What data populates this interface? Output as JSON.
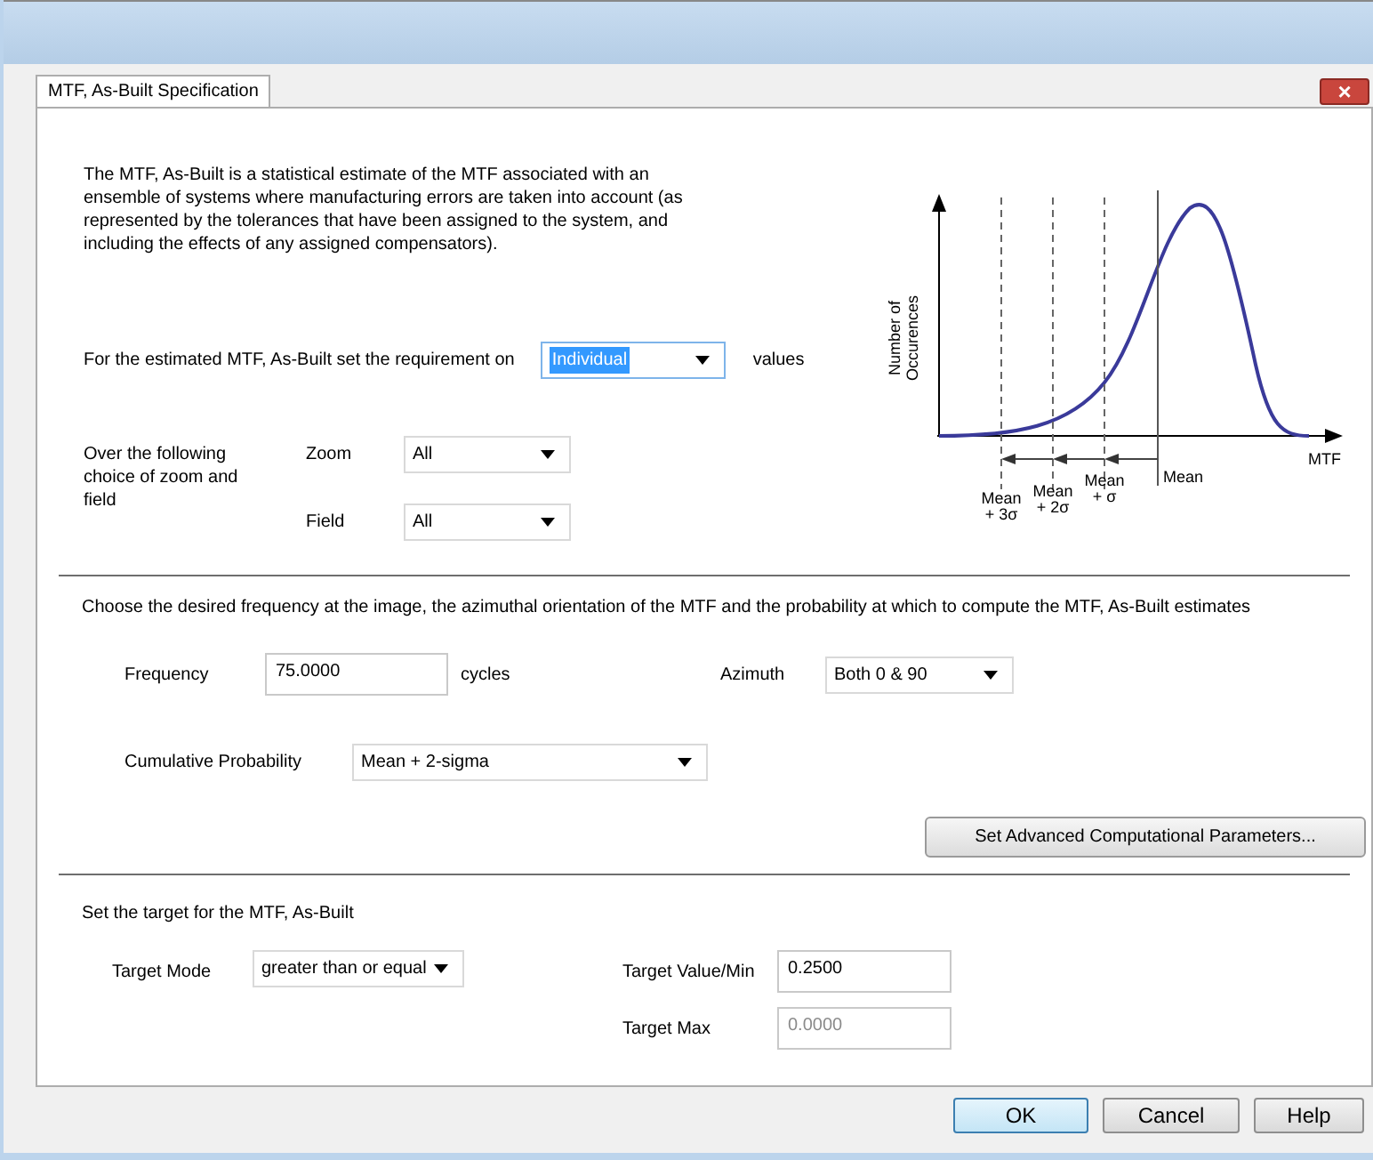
{
  "window": {
    "close": "×"
  },
  "tabs": [
    {
      "label": "MTF, As-Built Specification",
      "selected": true
    }
  ],
  "intro": "The MTF, As-Built  is a statistical estimate of the MTF associated with an ensemble of systems where manufacturing errors are taken into account (as represented by the tolerances that have been assigned to the system, and including the effects of any assigned compensators).",
  "requirement": {
    "label": "For the estimated MTF, As-Built set the requirement on",
    "value": "Individual",
    "suffix": "values"
  },
  "scope": {
    "label": "Over the following choice of zoom and field",
    "zoom": {
      "label": "Zoom",
      "value": "All"
    },
    "field": {
      "label": "Field",
      "value": "All"
    }
  },
  "diagram": {
    "ylabel": "Number of Occurences",
    "xlabel": "MTF",
    "markers": [
      {
        "line1": "Mean",
        "line2": "+ 3σ"
      },
      {
        "line1": "Mean",
        "line2": "+ 2σ"
      },
      {
        "line1": "Mean",
        "line2": "+ σ"
      }
    ],
    "mean": "Mean"
  },
  "compute": {
    "intro": "Choose the desired frequency at the image, the azimuthal orientation of the MTF and the probability at which to compute the MTF, As-Built estimates",
    "frequency": {
      "label": "Frequency",
      "value": "75.0000",
      "unit": "cycles"
    },
    "azimuth": {
      "label": "Azimuth",
      "value": "Both 0 & 90"
    },
    "probability": {
      "label": "Cumulative Probability",
      "value": "Mean + 2-sigma"
    },
    "advanced_button": "Set Advanced Computational Parameters..."
  },
  "target": {
    "intro": "Set the target for the MTF, As-Built",
    "mode": {
      "label": "Target Mode",
      "value": "greater than or equal"
    },
    "value_min": {
      "label": "Target Value/Min",
      "value": "0.2500",
      "disabled": false
    },
    "max": {
      "label": "Target Max",
      "value": "0.0000",
      "disabled": true
    }
  },
  "buttons": [
    {
      "label": "OK",
      "selected": true
    },
    {
      "label": "Cancel",
      "selected": false
    },
    {
      "label": "Help",
      "selected": false
    }
  ]
}
